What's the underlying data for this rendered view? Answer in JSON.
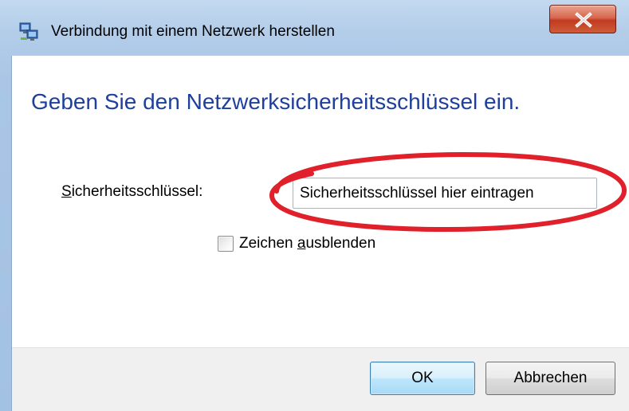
{
  "window": {
    "title": "Verbindung mit einem Netzwerk herstellen",
    "close_symbol": "X"
  },
  "content": {
    "heading": "Geben Sie den Netzwerksicherheitsschlüssel ein.",
    "key_label_access": "S",
    "key_label_rest": "icherheitsschlüssel:",
    "key_input_value": "Sicherheitsschlüssel hier eintragen",
    "hide_chars_prefix": "Zeichen ",
    "hide_chars_access": "a",
    "hide_chars_rest": "usblenden",
    "hide_chars_checked": false
  },
  "buttons": {
    "ok_label": "OK",
    "cancel_label": "Abbrechen"
  },
  "annotation": {
    "color": "#e0202a"
  },
  "icons": {
    "title_icon": "network-connect-icon",
    "close_icon": "close-icon"
  }
}
